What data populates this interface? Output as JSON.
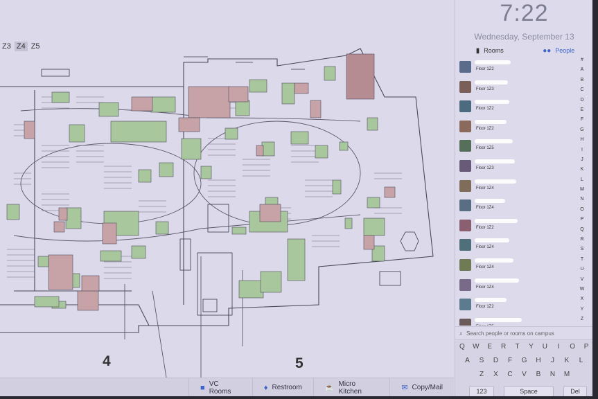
{
  "map": {
    "zone_tabs": [
      {
        "label": "Z3",
        "active": false
      },
      {
        "label": "Z4",
        "active": true
      },
      {
        "label": "Z5",
        "active": false
      }
    ],
    "zone_labels": [
      "4",
      "5"
    ]
  },
  "legend": {
    "items": [
      {
        "label": "VC Rooms",
        "icon": "video-camera-icon"
      },
      {
        "label": "Restroom",
        "icon": "restroom-icon"
      },
      {
        "label": "Micro Kitchen",
        "icon": "coffee-cup-icon"
      },
      {
        "label": "Copy/Mail",
        "icon": "envelope-icon"
      }
    ]
  },
  "panel": {
    "time": "7:22",
    "date": "Wednesday, September 13",
    "tabs": {
      "rooms": "Rooms",
      "people": "People"
    },
    "people": [
      {
        "floor": "Floor 1Z2"
      },
      {
        "floor": "Floor 1Z3"
      },
      {
        "floor": "Floor 1Z2"
      },
      {
        "floor": "Floor 1Z2"
      },
      {
        "floor": "Floor 1Z5"
      },
      {
        "floor": "Floor 1Z3"
      },
      {
        "floor": "Floor 1Z4"
      },
      {
        "floor": "Floor 1Z4"
      },
      {
        "floor": "Floor 1Z2"
      },
      {
        "floor": "Floor 1Z4"
      },
      {
        "floor": "Floor 1Z4"
      },
      {
        "floor": "Floor 1Z4"
      },
      {
        "floor": "Floor 1Z2"
      },
      {
        "floor": "Floor 1Z5"
      }
    ],
    "alphabet": [
      "#",
      "A",
      "B",
      "C",
      "D",
      "E",
      "F",
      "G",
      "H",
      "I",
      "J",
      "K",
      "L",
      "M",
      "N",
      "O",
      "P",
      "Q",
      "R",
      "S",
      "T",
      "U",
      "V",
      "W",
      "X",
      "Y",
      "Z"
    ],
    "search_placeholder": "Search people or rooms on campus",
    "keyboard": {
      "row1": [
        "Q",
        "W",
        "E",
        "R",
        "T",
        "Y",
        "U",
        "I",
        "O",
        "P"
      ],
      "row2": [
        "A",
        "S",
        "D",
        "F",
        "G",
        "H",
        "J",
        "K",
        "L"
      ],
      "row3": [
        "Z",
        "X",
        "C",
        "V",
        "B",
        "N",
        "M"
      ],
      "numbers": "123",
      "space": "Space",
      "delete": "Del"
    }
  },
  "colors": {
    "accent": "#3d64c9",
    "room_green": "#a9c79c",
    "room_pink": "#c7a3a8"
  }
}
